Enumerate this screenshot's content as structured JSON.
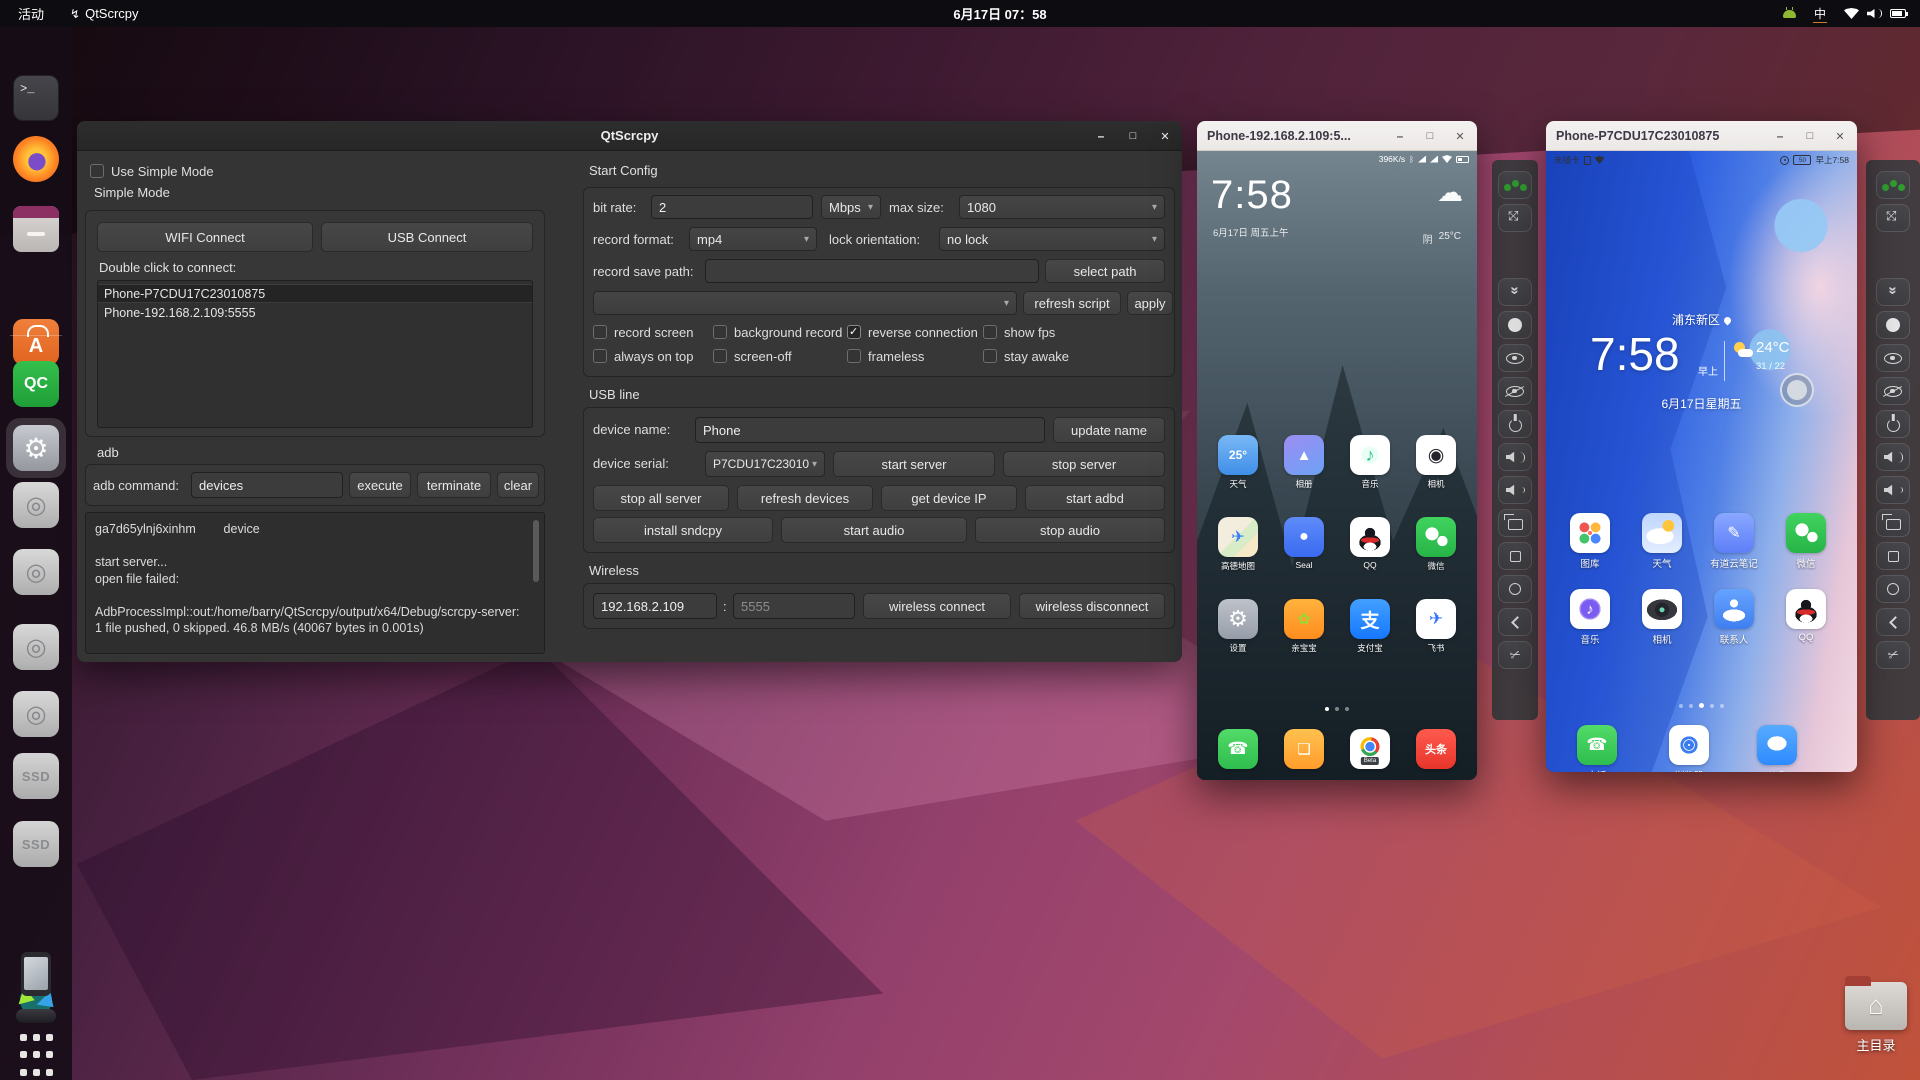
{
  "topbar": {
    "activities": "活动",
    "app_name": "QtScrcpy",
    "clock": "6月17日 07：58",
    "ime": "中"
  },
  "dock": {
    "qc_label": "QC",
    "ssd_label": "SSD"
  },
  "main": {
    "title": "QtScrcpy",
    "use_simple_mode": "Use Simple Mode",
    "simple_group": "Simple Mode",
    "wifi_connect": "WIFI Connect",
    "usb_connect": "USB Connect",
    "double_click": "Double click to connect:",
    "devices": [
      "Phone-P7CDU17C23010875",
      "Phone-192.168.2.109:5555"
    ],
    "adb_label": "adb",
    "adb_command_label": "adb command:",
    "adb_command_value": "devices",
    "execute": "execute",
    "terminate": "terminate",
    "clear": "clear",
    "log": "ga7d65ylnj6xinhm        device\n\nstart server...\nopen file failed:\n\nAdbProcessImpl::out:/home/barry/QtScrcpy/output/x64/Debug/scrcpy-server: 1 file pushed, 0 skipped. 46.8 MB/s (40067 bytes in 0.001s)",
    "start_config": {
      "title": "Start Config",
      "bit_rate_label": "bit rate:",
      "bit_rate": "2",
      "bit_rate_unit": "Mbps",
      "max_size_label": "max size:",
      "max_size": "1080",
      "record_format_label": "record format:",
      "record_format": "mp4",
      "lock_orientation_label": "lock orientation:",
      "lock_orientation": "no lock",
      "record_save_path_label": "record save path:",
      "record_save_path": "",
      "select_path": "select path",
      "script_value": "",
      "refresh_script": "refresh script",
      "apply": "apply",
      "checks": [
        {
          "label": "record screen",
          "checked": false
        },
        {
          "label": "background record",
          "checked": false
        },
        {
          "label": "reverse connection",
          "checked": true
        },
        {
          "label": "show fps",
          "checked": false
        },
        {
          "label": "always on top",
          "checked": false
        },
        {
          "label": "screen-off",
          "checked": false
        },
        {
          "label": "frameless",
          "checked": false
        },
        {
          "label": "stay awake",
          "checked": false
        }
      ]
    },
    "usb_line": {
      "title": "USB line",
      "device_name_label": "device name:",
      "device_name": "Phone",
      "update_name": "update name",
      "device_serial_label": "device serial:",
      "device_serial": "P7CDU17C23010",
      "start_server": "start server",
      "stop_server": "stop server",
      "stop_all_server": "stop all server",
      "refresh_devices": "refresh devices",
      "get_device_ip": "get device IP",
      "start_adbd": "start adbd",
      "install_sndcpy": "install sndcpy",
      "start_audio": "start audio",
      "stop_audio": "stop audio"
    },
    "wireless": {
      "title": "Wireless",
      "ip": "192.168.2.109",
      "sep": ":",
      "port_placeholder": "5555",
      "connect": "wireless connect",
      "disconnect": "wireless disconnect"
    }
  },
  "phone1": {
    "title": "Phone-192.168.2.109:5...",
    "status_speed": "396K/s",
    "status_bt": "ᛒ",
    "clock": "7:58",
    "date": "6月17日 周五上午",
    "weather_cond": "阴",
    "weather_temp": "25°C",
    "cloud_glyph": "☁",
    "apps": [
      {
        "label": "天气",
        "glyph": "25°",
        "css": "background:linear-gradient(180deg,#79b8f5,#3f8ee8);color:#fff;font-size:12px;font-weight:bold"
      },
      {
        "label": "相册",
        "glyph": "▲",
        "css": "background:linear-gradient(150deg,#9d8df2,#6ba2f5);color:#fff;font-size:15px"
      },
      {
        "label": "音乐",
        "glyph": "♪",
        "css": "background:radial-gradient(circle at 50% 50%,#e9fff6 0 30%,transparent 31%),#fff;color:#2fc08a;font-size:18px"
      },
      {
        "label": "相机",
        "glyph": "◉",
        "css": "background:#fff;color:#23232b;font-size:19px"
      },
      {
        "label": "高德地图",
        "glyph": "✈",
        "css": "background:linear-gradient(135deg,#f2eddc 0 48%,#d8ecc8 48% 70%,#f5e9c8 70%);color:#2f7df6;font-size:16px"
      },
      {
        "label": "Seal",
        "glyph": "●",
        "css": "background:linear-gradient(180deg,#5f8cfa,#3a6af0);color:#fff;font-size:16px"
      },
      {
        "label": "QQ",
        "glyph": "",
        "css": "background:radial-gradient(ellipse 16% 10% at 50% 74%,#fff 0 99%,transparent 100%),radial-gradient(ellipse 23% 7% at 50% 58%,#d92b2b 0 99%,transparent 100%),radial-gradient(circle at 50% 40%,#17181d 0 16%,transparent 17%),radial-gradient(ellipse 27% 20% at 50% 64%,#17181d 0 99%,transparent 100%),#fff"
      },
      {
        "label": "微信",
        "glyph": "",
        "css": "background:radial-gradient(circle at 40% 42%,#fff 0 19%,transparent 20%),radial-gradient(circle at 66% 60%,#fff 0 14%,transparent 15%),linear-gradient(180deg,#40d35e,#27b447)"
      },
      {
        "label": "设置",
        "glyph": "⚙",
        "css": "background:linear-gradient(180deg,#bdc2ca,#979da8);color:#fff;font-size:22px"
      },
      {
        "label": "亲宝宝",
        "glyph": "✿",
        "css": "background:linear-gradient(180deg,#ffb23d,#ff8d1e);color:#9bd938;font-size:15px"
      },
      {
        "label": "支付宝",
        "glyph": "支",
        "css": "background:linear-gradient(180deg,#42a0ff,#1677ff);color:#fff;font-size:19px;font-weight:bold"
      },
      {
        "label": "飞书",
        "glyph": "✈",
        "css": "background:#fff;color:#3370ff;font-size:17px"
      }
    ],
    "dock": [
      {
        "name": "phone",
        "glyph": "☎",
        "css": "background:linear-gradient(180deg,#52db68,#2ebd4e);color:#fff;font-size:17px"
      },
      {
        "name": "messages",
        "glyph": "❏",
        "css": "background:linear-gradient(180deg,#ffc14f,#ff9d2b);color:#fff;font-size:15px;font-weight:bold"
      },
      {
        "name": "chrome-beta",
        "glyph": "",
        "sub": "Beta",
        "css": "background:radial-gradient(circle at 50% 44%,transparent 0 31%,#fff 32%),radial-gradient(circle at 50% 44%,#4285f4 0 15%,#fff 16% 20%,transparent 21%),conic-gradient(from 130deg at 50% 44%,#34a853 0 120deg,#fbbc05 0 240deg,#ea4335 0 360deg)"
      },
      {
        "name": "toutiao",
        "glyph": "头条",
        "css": "background:linear-gradient(180deg,#ff5a4e,#e8352a);color:#fff;font-size:11px;font-weight:bold"
      }
    ]
  },
  "phone2": {
    "title": "Phone-P7CDU17C23010875",
    "status_left": "未插卡",
    "battery": "50",
    "status_time": "早上7:58",
    "location": "浦东新区",
    "clock": "7:58",
    "ampm": "早上",
    "temp": "24°C",
    "temp_range": "31 / 22",
    "date": "6月17日星期五",
    "apps": [
      {
        "label": "图库",
        "glyph": "",
        "css": "background:radial-gradient(circle at 36% 36%,#f0564f 0 13%,transparent 14%),radial-gradient(circle at 64% 36%,#ffb83d 0 13%,transparent 14%),radial-gradient(circle at 36% 64%,#43c46a 0 13%,transparent 14%),radial-gradient(circle at 64% 64%,#4a86ff 0 13%,transparent 14%),radial-gradient(circle at 50% 50%,#ff6f61 0 7%,transparent 8%),#fff"
      },
      {
        "label": "天气",
        "glyph": "",
        "css": "background:radial-gradient(circle at 66% 32%,#ffc53d 0 15%,transparent 16%),radial-gradient(ellipse 34% 20% at 45% 58%,#fff 0 99%,transparent 100%),linear-gradient(180deg,#bfd6ff,#e2edff)"
      },
      {
        "label": "有道云笔记",
        "glyph": "✎",
        "css": "background:linear-gradient(180deg,#8aa8ff,#5d7ef8);color:#fff;font-size:16px"
      },
      {
        "label": "微信",
        "glyph": "",
        "css": "background:radial-gradient(circle at 40% 42%,#fff 0 19%,transparent 20%),radial-gradient(circle at 66% 60%,#fff 0 14%,transparent 15%),linear-gradient(180deg,#40d35e,#27b447)"
      },
      {
        "label": "音乐",
        "glyph": "♪",
        "css": "background:radial-gradient(circle at 50% 50%,#7a5cf0 0 32%,#a88cf5 33% 37%,transparent 38%),#fff;color:#fff;font-size:15px"
      },
      {
        "label": "相机",
        "glyph": "",
        "css": "background:radial-gradient(circle at 50% 52%,#69d6b1 0 8%,transparent 9%),radial-gradient(circle at 50% 52%,#23242c 0 24%,transparent 25%),radial-gradient(ellipse 38% 26% at 50% 52%,#35363e 0 99%,transparent 100%),#fff"
      },
      {
        "label": "联系人",
        "glyph": "",
        "css": "background:radial-gradient(circle at 50% 36%,#fff 0 12%,transparent 13%),radial-gradient(ellipse 28% 15% at 50% 66%,#fff 0 99%,transparent 100%),linear-gradient(180deg,#66a3ff,#3f7ef0)"
      },
      {
        "label": "QQ",
        "glyph": "",
        "css": "background:radial-gradient(ellipse 16% 10% at 50% 74%,#fff 0 99%,transparent 100%),radial-gradient(ellipse 23% 7% at 50% 58%,#d92b2b 0 99%,transparent 100%),radial-gradient(circle at 50% 40%,#17181d 0 16%,transparent 17%),radial-gradient(ellipse 27% 20% at 50% 64%,#17181d 0 99%,transparent 100%),#fff"
      }
    ],
    "dock": [
      {
        "label": "电话",
        "glyph": "☎",
        "css": "background:linear-gradient(180deg,#52db68,#2ebd4e);color:#fff;font-size:17px"
      },
      {
        "label": "浏览器",
        "glyph": "",
        "css": "background:radial-gradient(circle at 50% 50%,#fff 0 3%,transparent 4%),radial-gradient(circle at 50% 50%,transparent 0 17%,#fff 18% 20%,transparent 21%),radial-gradient(circle at 50% 50%,#3b7df0 0 30%,transparent 31%),#fff"
      },
      {
        "label": "信息",
        "glyph": "",
        "css": "background:radial-gradient(ellipse 24% 18% at 50% 46%,#fff 0 99%,transparent 100%),linear-gradient(180deg,#57abff,#2e8bff)"
      }
    ]
  },
  "toolbar": {
    "buttons": [
      "group-control",
      "full-screen",
      "expand-collapse",
      "touch-ball",
      "screen-on",
      "screen-off",
      "power",
      "volume-up",
      "volume-down",
      "app-switch",
      "menu",
      "home",
      "back",
      "screenshot"
    ]
  },
  "desktop": {
    "home_label": "主目录"
  },
  "colors": {
    "accent_orange": "#E95420",
    "topbar_bg": "#0d0c10",
    "window_bg": "#343434",
    "wechat_green": "#27b447"
  }
}
